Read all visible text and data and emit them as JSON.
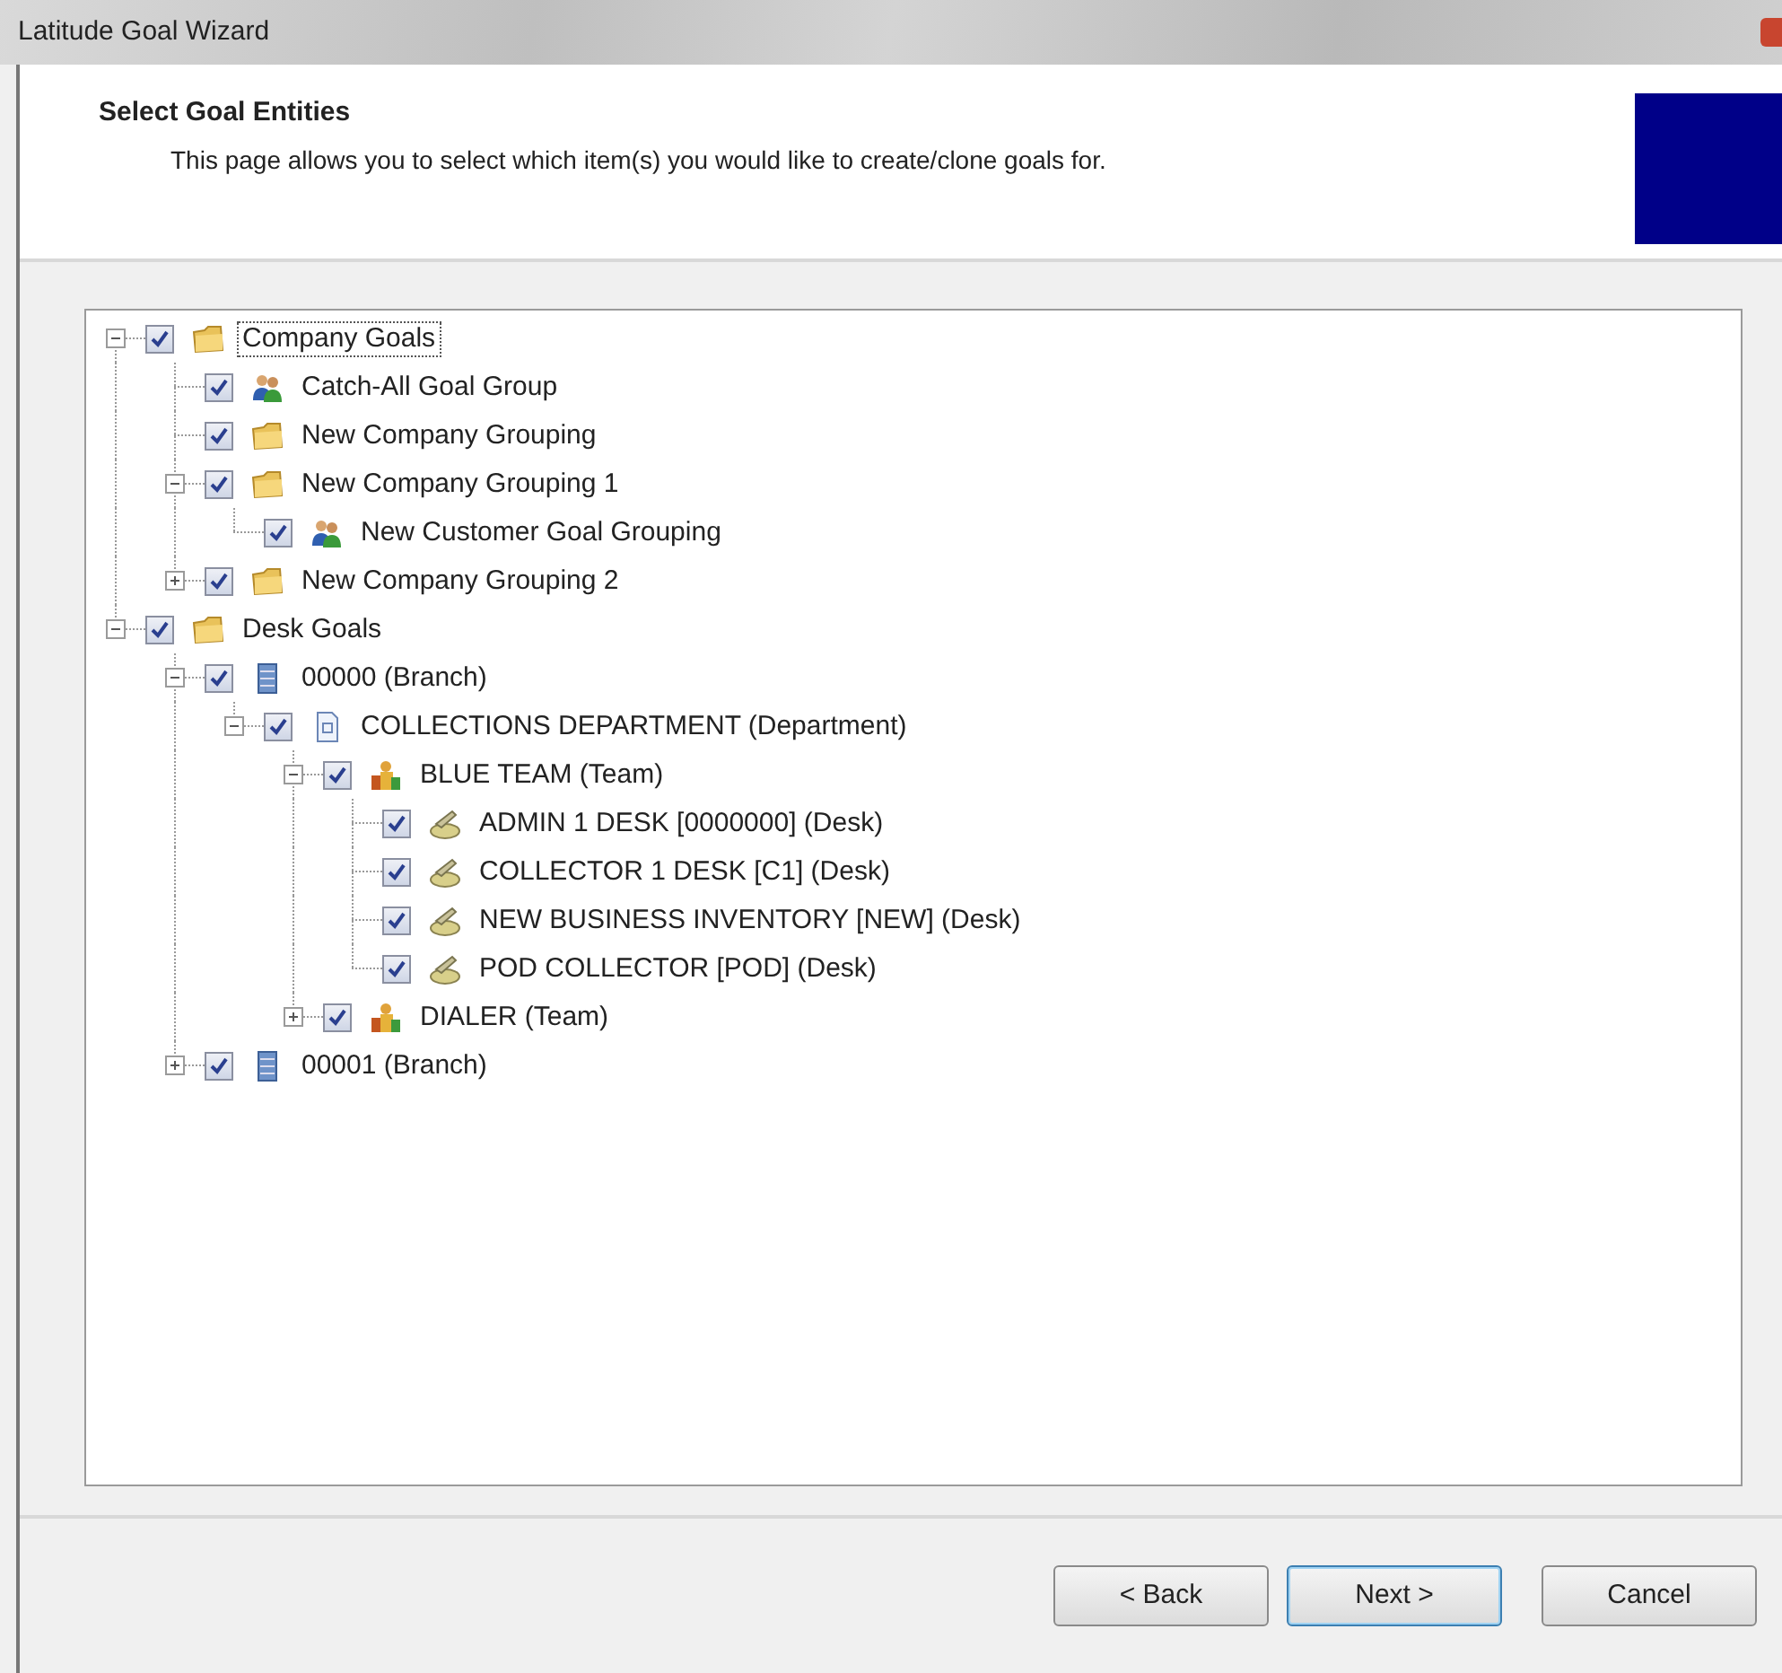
{
  "window": {
    "title": "Latitude Goal Wizard"
  },
  "header": {
    "title": "Select Goal Entities",
    "description": "This page allows you to select which item(s) you would like to create/clone goals for."
  },
  "tree": [
    {
      "label": "Company Goals",
      "kind": "folder",
      "checked": true,
      "selected": true,
      "expanded": true,
      "children": [
        {
          "label": "Catch-All Goal Group",
          "kind": "people",
          "checked": true,
          "selected": false
        },
        {
          "label": "New Company Grouping",
          "kind": "folder",
          "checked": true,
          "selected": false
        },
        {
          "label": "New Company Grouping 1",
          "kind": "folder",
          "checked": true,
          "selected": false,
          "expanded": true,
          "children": [
            {
              "label": "New Customer Goal Grouping",
              "kind": "people",
              "checked": true,
              "selected": false
            }
          ]
        },
        {
          "label": "New Company Grouping 2",
          "kind": "folder",
          "checked": true,
          "selected": false,
          "expanded": false
        }
      ]
    },
    {
      "label": "Desk Goals",
      "kind": "folder",
      "checked": true,
      "selected": false,
      "expanded": true,
      "children": [
        {
          "label": "00000 (Branch)",
          "kind": "branch",
          "checked": true,
          "selected": false,
          "expanded": true,
          "children": [
            {
              "label": "COLLECTIONS DEPARTMENT (Department)",
              "kind": "department",
              "checked": true,
              "selected": false,
              "expanded": true,
              "children": [
                {
                  "label": "BLUE TEAM (Team)",
                  "kind": "team",
                  "checked": true,
                  "selected": false,
                  "expanded": true,
                  "children": [
                    {
                      "label": "ADMIN 1 DESK [0000000] (Desk)",
                      "kind": "desk",
                      "checked": true,
                      "selected": false
                    },
                    {
                      "label": "COLLECTOR 1 DESK [C1] (Desk)",
                      "kind": "desk",
                      "checked": true,
                      "selected": false
                    },
                    {
                      "label": "NEW BUSINESS INVENTORY [NEW] (Desk)",
                      "kind": "desk",
                      "checked": true,
                      "selected": false
                    },
                    {
                      "label": "POD COLLECTOR [POD] (Desk)",
                      "kind": "desk",
                      "checked": true,
                      "selected": false
                    }
                  ]
                },
                {
                  "label": "DIALER (Team)",
                  "kind": "team",
                  "checked": true,
                  "selected": false,
                  "expanded": false
                }
              ]
            }
          ]
        },
        {
          "label": "00001 (Branch)",
          "kind": "branch",
          "checked": true,
          "selected": false,
          "expanded": false
        }
      ]
    }
  ],
  "buttons": [
    {
      "label": "< Back",
      "default": false
    },
    {
      "label": "Next >",
      "default": true
    },
    {
      "label": "Cancel",
      "default": false
    }
  ]
}
